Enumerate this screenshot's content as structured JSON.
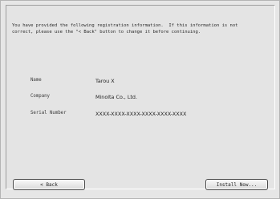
{
  "intro": {
    "text": "You have provided the following registration information.  If this information is not\ncorrect, please use the \"< Back\" button to change it before continuing."
  },
  "registration": {
    "fields": [
      {
        "label": "Name",
        "value": "Tarou X"
      },
      {
        "label": "Company",
        "value": "Minolta Co., Ltd."
      },
      {
        "label": "Serial Number",
        "value": "XXXX-XXXX-XXXX-XXXX-XXXX-XXXX"
      }
    ]
  },
  "buttons": {
    "back_label": "< Back",
    "install_label": "Install Now..."
  }
}
